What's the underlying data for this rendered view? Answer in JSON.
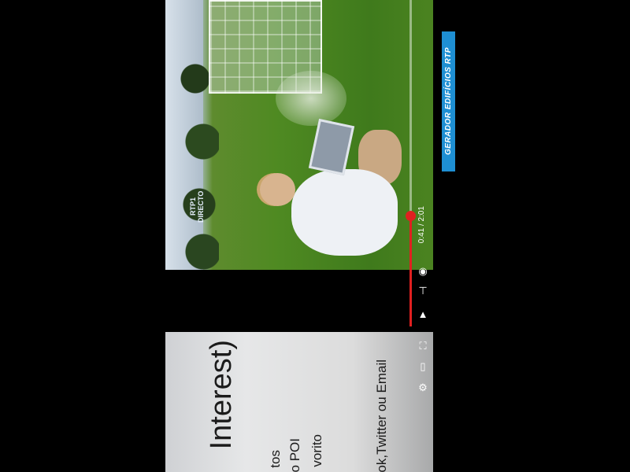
{
  "video": {
    "channel_logo": "RTP1 DIRECTO",
    "elapsed": "0:41",
    "duration": "2:01",
    "time_display": "0:41 / 2:01",
    "progress": 0.34,
    "caption": "GERADOR EDIFÍCIOS RTP",
    "controls": {
      "play_icon": "play-icon",
      "next_icon": "skip-next-icon",
      "volume_icon": "volume-icon"
    }
  },
  "slide": {
    "title": "Interest)",
    "bullets": [
      "tos",
      "o POI",
      "vorito",
      "ok,Twitter ou Email"
    ],
    "controls": {
      "fullscreen_icon": "fullscreen-icon",
      "cast_icon": "screen-icon",
      "settings_icon": "gear-icon"
    }
  },
  "colors": {
    "accent_red": "#e02020",
    "caption_blue": "#1e8fd3",
    "background": "#000000"
  }
}
